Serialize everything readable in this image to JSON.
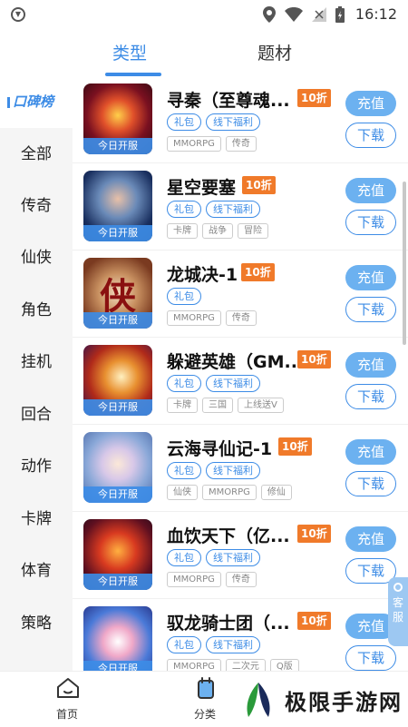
{
  "status": {
    "time": "16:12"
  },
  "topnav": {
    "tabs": [
      "类型",
      "题材"
    ]
  },
  "sidebar": {
    "active": "口碑榜",
    "items": [
      "全部",
      "传奇",
      "仙侠",
      "角色",
      "挂机",
      "回合",
      "动作",
      "卡牌",
      "体育",
      "策略"
    ]
  },
  "games": [
    {
      "name": "寻秦（至尊魂...",
      "discount": "10折",
      "tags": [
        "礼包",
        "线下福利"
      ],
      "genres": [
        "MMORPG",
        "传奇"
      ],
      "badge": "今日开服",
      "recharge": "充值",
      "download": "下载"
    },
    {
      "name": "星空要塞",
      "discount": "10折",
      "tags": [
        "礼包",
        "线下福利"
      ],
      "genres": [
        "卡牌",
        "战争",
        "冒险"
      ],
      "badge": "今日开服",
      "recharge": "充值",
      "download": "下载"
    },
    {
      "name": "龙城决-1",
      "discount": "10折",
      "tags": [
        "礼包"
      ],
      "genres": [
        "MMORPG",
        "传奇"
      ],
      "badge": "今日开服",
      "recharge": "充值",
      "download": "下载",
      "thumb_text": "侠"
    },
    {
      "name": "躲避英雄（GM...",
      "discount": "10折",
      "tags": [
        "礼包",
        "线下福利"
      ],
      "genres": [
        "卡牌",
        "三国",
        "上线送V"
      ],
      "badge": "今日开服",
      "recharge": "充值",
      "download": "下载"
    },
    {
      "name": "云海寻仙记-1",
      "discount": "10折",
      "tags": [
        "礼包",
        "线下福利"
      ],
      "genres": [
        "仙侠",
        "MMORPG",
        "修仙"
      ],
      "badge": "今日开服",
      "recharge": "充值",
      "download": "下载"
    },
    {
      "name": "血饮天下（亿...",
      "discount": "10折",
      "tags": [
        "礼包",
        "线下福利"
      ],
      "genres": [
        "MMORPG",
        "传奇"
      ],
      "badge": "今日开服",
      "recharge": "充值",
      "download": "下载"
    },
    {
      "name": "驭龙骑士团（...",
      "discount": "10折",
      "tags": [
        "礼包",
        "线下福利"
      ],
      "genres": [
        "MMORPG",
        "二次元",
        "Q版"
      ],
      "badge": "今日开服",
      "recharge": "充值",
      "download": "下载"
    }
  ],
  "service": {
    "label": "客服"
  },
  "bottomnav": {
    "home": "首页",
    "category": "分类"
  },
  "watermark": {
    "text": "极限手游网"
  },
  "colors": {
    "accent": "#3d8ce6",
    "discount": "#f07a2a",
    "recharge_bg": "#6cb1f0"
  }
}
